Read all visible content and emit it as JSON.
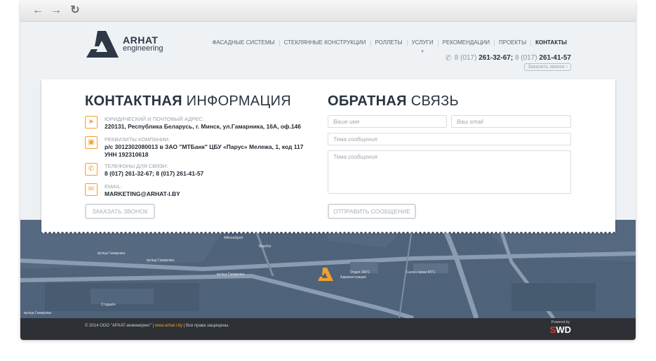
{
  "browser": {
    "back_icon": "arrow-left-icon",
    "forward_icon": "arrow-right-icon",
    "reload_icon": "reload-icon"
  },
  "logo": {
    "name": "ARHAT",
    "subtitle": "engineering"
  },
  "menu": [
    {
      "label": "ФАСАДНЫЕ СИСТЕМЫ"
    },
    {
      "label": "СТЕКЛЯННЫЕ КОНСТРУКЦИИ"
    },
    {
      "label": "РОЛЛЕТЫ"
    },
    {
      "label": "УСЛУГИ"
    },
    {
      "label": "РЕКОМЕНДАЦИИ"
    },
    {
      "label": "ПРОЕКТЫ"
    },
    {
      "label": "КОНТАКТЫ"
    }
  ],
  "header_phones": {
    "code1": "8 (017)",
    "num1": "261-32-67;",
    "code2": "8 (017)",
    "num2": "261-41-57"
  },
  "callback_small": "Заказать звонок",
  "contacts": {
    "title_bold": "КОНТАКТНАЯ",
    "title_rest": "ИНФОРМАЦИЯ",
    "address_label": "ЮРИДИЧЕСКИЙ И ПОЧТОВЫЙ АДРЕС:",
    "address_value": "220131, Республика Беларусь, г. Минск, ул.Гамарника, 16А, оф.146",
    "requisites_label": "РЕКВИЗИТЫ КОМПАНИИ:",
    "requisites_value1": "р/с 3012302080013 в ЗАО \"МТБанк\" ЦБУ «Парус» Мележа, 1, код 117",
    "requisites_value2": "УНН 192310618",
    "phones_label": "ТЕЛЕФОНЫ ДЛЯ СВЯЗИ:",
    "phones_value": "8 (017) 261-32-67; 8 (017) 261-41-57",
    "email_label": "EMAIL:",
    "email_value": "MARKETING@ARHAT-I.BY",
    "callback_button": "ЗАКАЗАТЬ ЗВОНОК"
  },
  "feedback": {
    "title_bold": "ОБРАТНАЯ",
    "title_rest": "СВЯЗЬ",
    "name_placeholder": "Ваше имя",
    "email_placeholder": "Ваш email",
    "subject_placeholder": "Тема сообщения",
    "message_placeholder": "Тема сообщения",
    "send_button": "ОТПРАВИТЬ СООБЩЕНИЕ"
  },
  "map_labels": {
    "street1": "вуліца Гамарніка",
    "street2": "вуліца Гамарніка",
    "street3": "вуліца Гамарніка",
    "stadium": "Стадыён",
    "sport": "AffectaSport",
    "vitebsk": "Віцебск",
    "zags": "Отдел ЗАГС",
    "admin": "Администрации",
    "mts": "Салон связи МТС",
    "street4": "вуліца Гамарніка"
  },
  "footer": {
    "copyright": "© 2014 ООО \"АРХАТ-инжиниринг\" |",
    "link": "www.arhat-i.by",
    "rights": "| Все права защищены.",
    "powered_label": "Powered by",
    "powered_s": "S",
    "powered_rest": "WD"
  }
}
